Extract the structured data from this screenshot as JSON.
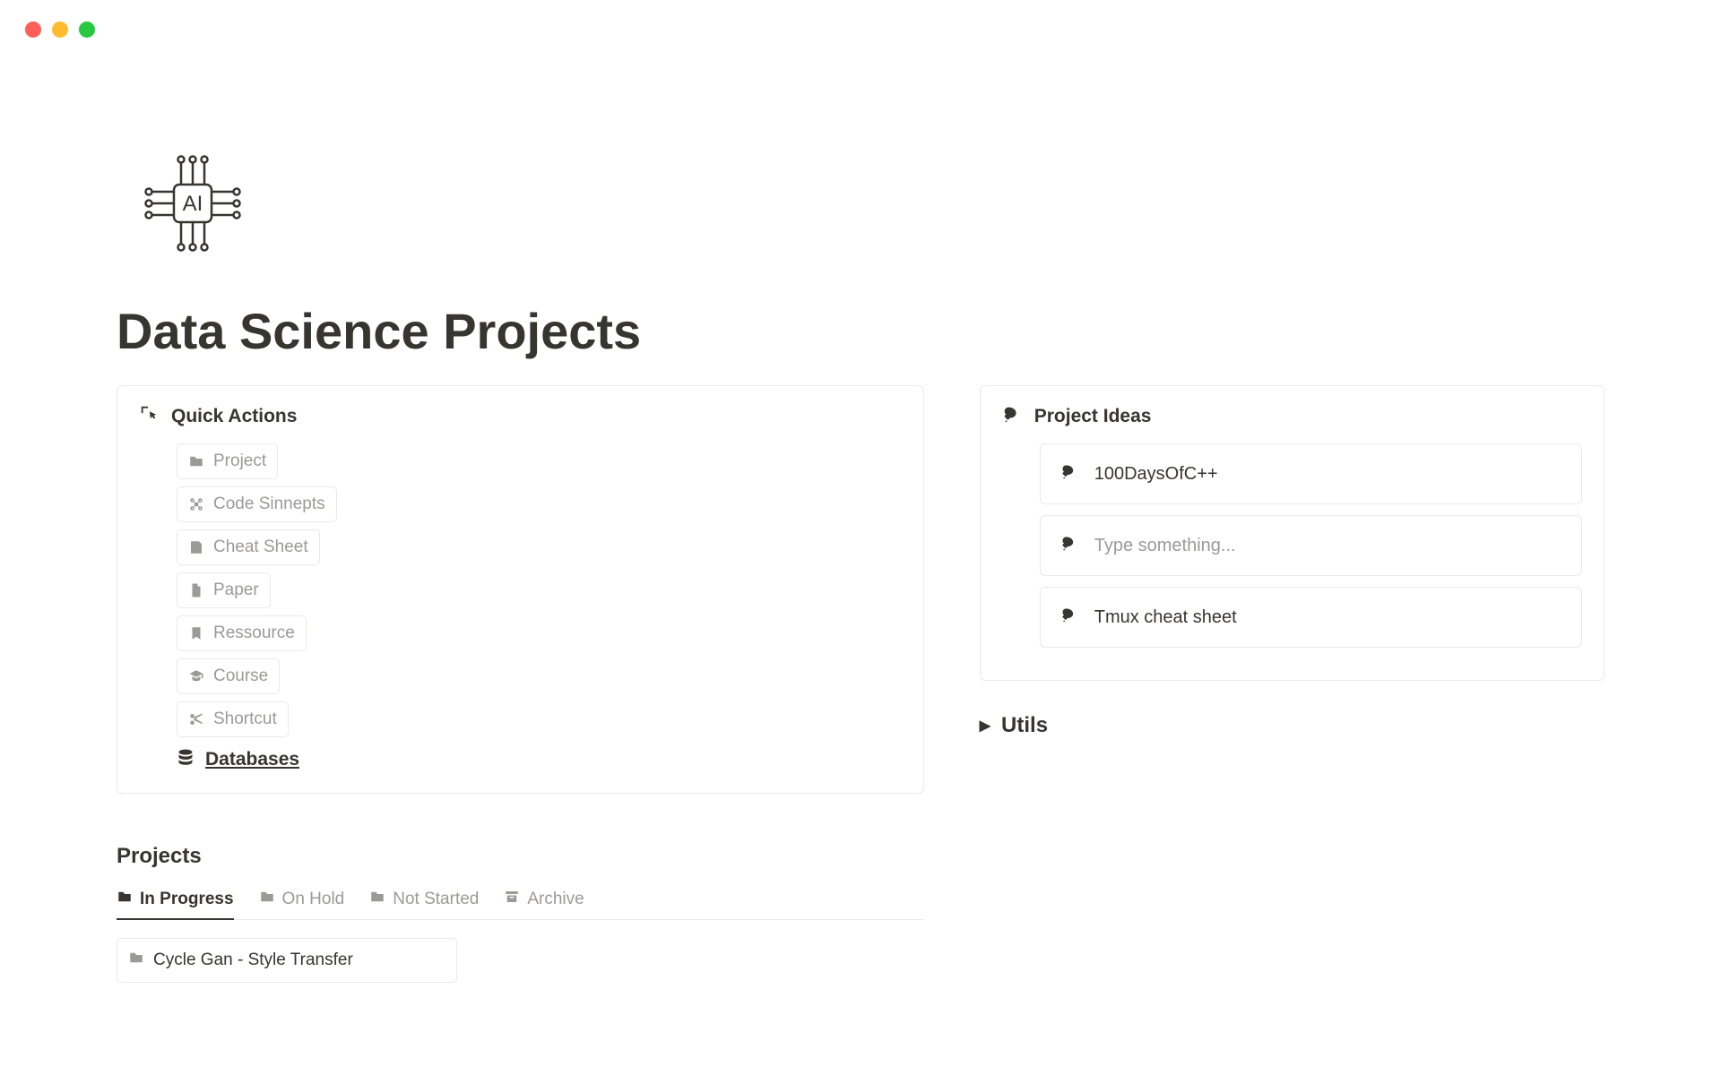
{
  "page": {
    "title": "Data Science Projects"
  },
  "quick_actions": {
    "title": "Quick Actions",
    "items": [
      {
        "label": "Project"
      },
      {
        "label": "Code Sinnepts"
      },
      {
        "label": "Cheat Sheet"
      },
      {
        "label": "Paper"
      },
      {
        "label": "Ressource"
      },
      {
        "label": "Course"
      },
      {
        "label": "Shortcut"
      }
    ],
    "databases_label": "Databases"
  },
  "project_ideas": {
    "title": "Project Ideas",
    "items": [
      {
        "label": "100DaysOfC++"
      },
      {
        "label": "Type something...",
        "placeholder": true
      },
      {
        "label": "Tmux cheat sheet"
      }
    ]
  },
  "utils": {
    "title": "Utils"
  },
  "projects": {
    "title": "Projects",
    "tabs": [
      {
        "label": "In Progress",
        "active": true
      },
      {
        "label": "On Hold"
      },
      {
        "label": "Not Started"
      },
      {
        "label": "Archive"
      }
    ],
    "rows": [
      {
        "label": "Cycle Gan - Style Transfer"
      }
    ]
  }
}
